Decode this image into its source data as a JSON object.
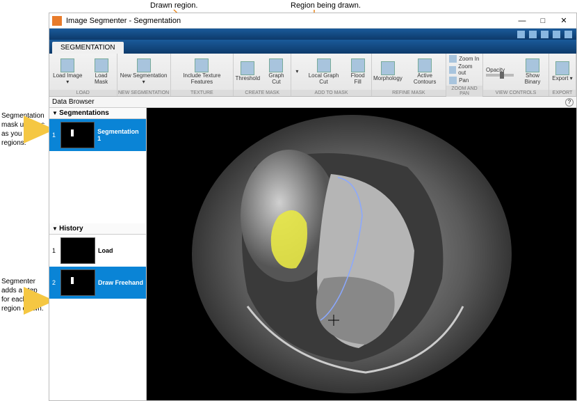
{
  "top_annotations": {
    "drawn": "Drawn region.",
    "being_drawn": "Region being drawn."
  },
  "left_annotations": {
    "mask": "Segmentation mask updates as you draw regions.",
    "step": "Segmenter adds a step for each region drawn."
  },
  "window": {
    "title": "Image Segmenter - Segmentation",
    "min": "—",
    "max": "□",
    "close": "✕"
  },
  "tab": "SEGMENTATION",
  "ribbon": {
    "load": {
      "lbl": "LOAD",
      "b1": "Load Image ▾",
      "b2": "Load Mask"
    },
    "newseg": {
      "lbl": "NEW SEGMENTATION",
      "b1": "New Segmentation ▾"
    },
    "texture": {
      "lbl": "TEXTURE",
      "b1": "Include Texture Features"
    },
    "create": {
      "lbl": "CREATE MASK",
      "b1": "Threshold",
      "b2": "Graph Cut"
    },
    "addto": {
      "lbl": "ADD TO MASK",
      "dd": "▾",
      "b1": "Local Graph Cut",
      "b2": "Flood Fill"
    },
    "refine": {
      "lbl": "REFINE MASK",
      "b1": "Morphology",
      "b2": "Active Contours"
    },
    "zoom": {
      "lbl": "ZOOM AND PAN",
      "in": "Zoom In",
      "out": "Zoom out",
      "pan": "Pan"
    },
    "view": {
      "lbl": "VIEW CONTROLS",
      "op": "Opacity",
      "sb": "Show Binary"
    },
    "export": {
      "lbl": "EXPORT",
      "b1": "Export ▾"
    }
  },
  "databrowser": "Data Browser",
  "side": {
    "seg_hdr": "Segmentations",
    "seg1_n": "1",
    "seg1": "Segmentation 1",
    "hist_hdr": "History",
    "h1_n": "1",
    "h1": "Load",
    "h2_n": "2",
    "h2": "Draw Freehand"
  }
}
